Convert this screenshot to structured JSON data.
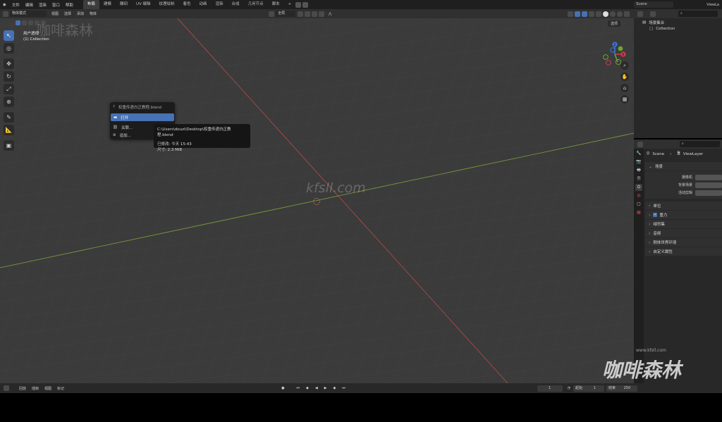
{
  "topbar": {
    "menus": [
      "文件",
      "编辑",
      "渲染",
      "窗口",
      "帮助"
    ],
    "workspaces": [
      {
        "label": "布局",
        "active": true
      },
      {
        "label": "建模",
        "active": false
      },
      {
        "label": "雕刻",
        "active": false
      },
      {
        "label": "UV 编辑",
        "active": false
      },
      {
        "label": "纹理绘制",
        "active": false
      },
      {
        "label": "着色",
        "active": false
      },
      {
        "label": "动画",
        "active": false
      },
      {
        "label": "渲染",
        "active": false
      },
      {
        "label": "合成",
        "active": false
      },
      {
        "label": "几何节点",
        "active": false
      },
      {
        "label": "脚本",
        "active": false
      }
    ],
    "add_tab": "+",
    "scene_name": "Scene",
    "view_layer": "ViewLa"
  },
  "viewport": {
    "mode": "物体模式",
    "menus": [
      "视图",
      "选择",
      "添加",
      "物体"
    ],
    "transform_orientation": "全局",
    "overlay_label": "选项",
    "view_name": "用户透视",
    "collection_label": "(1) Collection",
    "watermark_center": "kfsll.com",
    "watermark_topleft": "咖啡森林"
  },
  "context_menu": {
    "title": "权重传递白正教程.blend",
    "items": [
      {
        "label": "打开",
        "highlighted": true,
        "icon": "folder-icon"
      },
      {
        "label": "关联...",
        "highlighted": false,
        "icon": "link-icon"
      },
      {
        "label": "追加...",
        "highlighted": false,
        "icon": "append-icon"
      }
    ]
  },
  "tooltip": {
    "path": "C:\\Users\\douzi\\Desktop\\权重传递白正教程.blend",
    "modified": "已修改: 今天 15:43",
    "size": "尺寸: 2.3 MiB"
  },
  "outliner": {
    "root": "场景集合",
    "collection": "Collection"
  },
  "properties": {
    "breadcrumb_scene": "Scene",
    "breadcrumb_layer": "ViewLayer",
    "scene_panel": "场景",
    "fields": [
      {
        "label": "摄像机"
      },
      {
        "label": "背景场景"
      },
      {
        "label": "活动剪辑"
      }
    ],
    "panels": [
      {
        "label": "单位",
        "checkbox": false
      },
      {
        "label": "重力",
        "checkbox": true
      },
      {
        "label": "绿帘集",
        "checkbox": false
      },
      {
        "label": "音频",
        "checkbox": false
      },
      {
        "label": "刚体世界环境",
        "checkbox": false
      },
      {
        "label": "自定义属性",
        "checkbox": false
      }
    ]
  },
  "timeline": {
    "menus": [
      "回放",
      "插帧",
      "视图",
      "标记"
    ],
    "current_frame": "1",
    "start_label": "起始",
    "start": "1",
    "end_label": "结束",
    "end": "250"
  },
  "watermark_brand": {
    "url": "www.kfsll.com",
    "name": "咖啡森林"
  },
  "colors": {
    "accent": "#4772b3",
    "x_axis": "#b84a4a",
    "y_axis": "#7ea33a",
    "gizmo_x": "#d33a4a",
    "gizmo_y": "#6aa82f",
    "gizmo_z": "#3a78d8"
  }
}
